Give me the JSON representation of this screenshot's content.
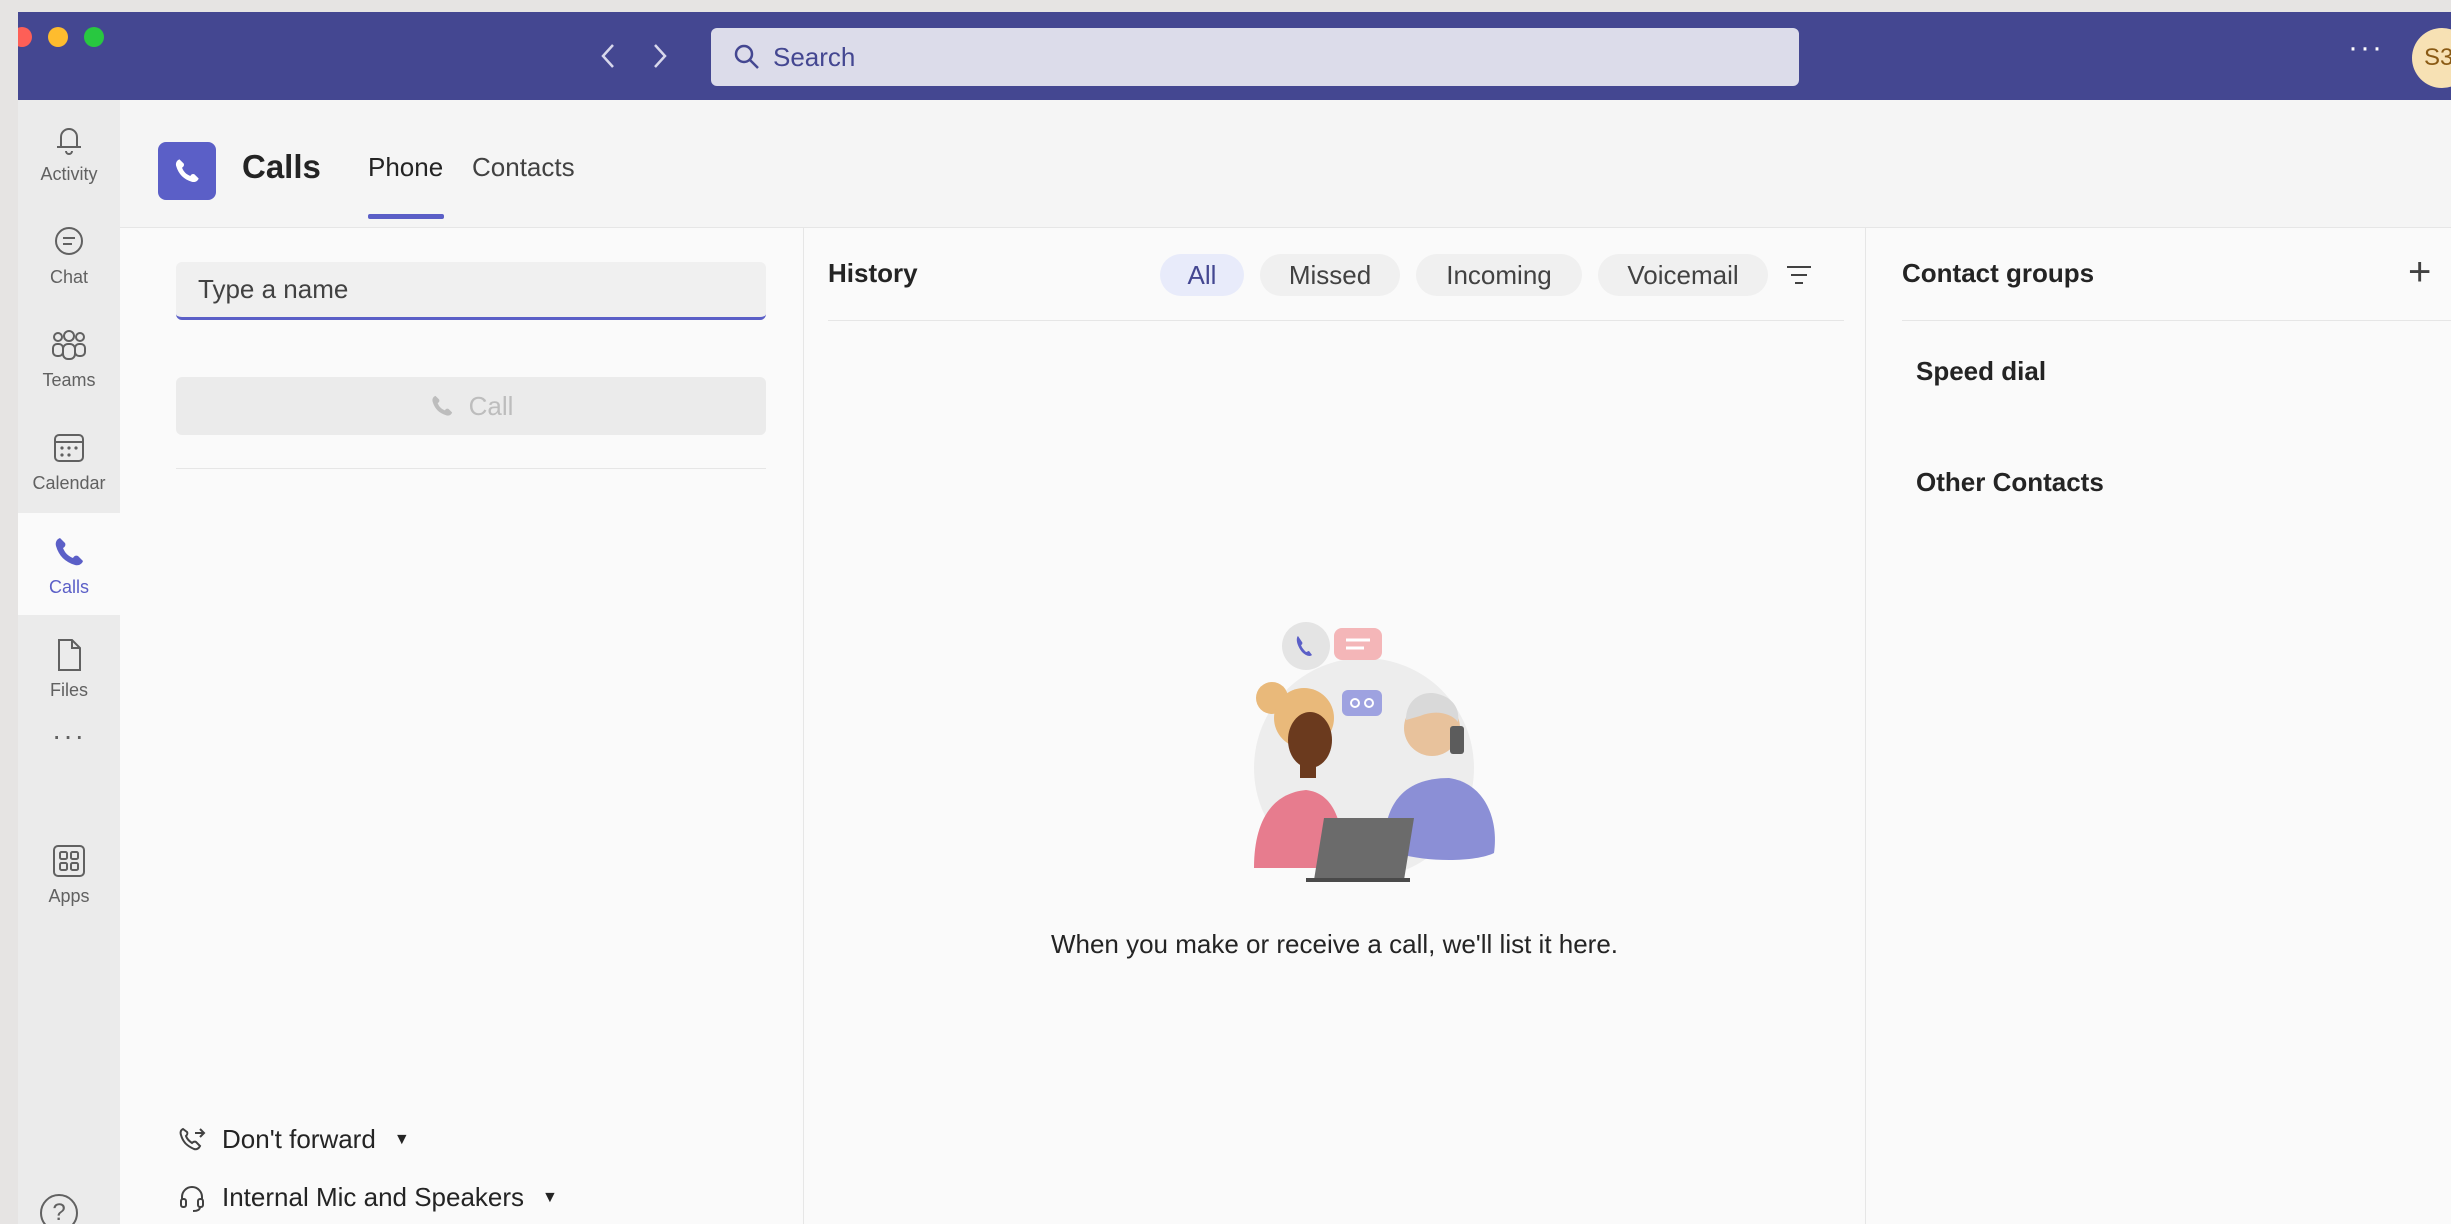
{
  "titlebar": {
    "search_placeholder": "Search",
    "more_label": "···",
    "avatar_initials": "S3"
  },
  "rail": {
    "items": [
      {
        "label": "Activity",
        "icon": "bell-icon"
      },
      {
        "label": "Chat",
        "icon": "chat-icon"
      },
      {
        "label": "Teams",
        "icon": "teams-icon"
      },
      {
        "label": "Calendar",
        "icon": "calendar-icon"
      },
      {
        "label": "Calls",
        "icon": "phone-icon",
        "active": true
      },
      {
        "label": "Files",
        "icon": "file-icon"
      },
      {
        "label": "···",
        "icon": "more-icon"
      },
      {
        "label": "Apps",
        "icon": "apps-icon"
      }
    ],
    "help_label": "?"
  },
  "header": {
    "title": "Calls",
    "tabs": [
      {
        "label": "Phone",
        "active": true
      },
      {
        "label": "Contacts",
        "active": false
      }
    ]
  },
  "dialer": {
    "input_placeholder": "Type a name",
    "call_label": "Call",
    "forward_label": "Don't forward",
    "device_label": "Internal Mic and Speakers"
  },
  "history": {
    "title": "History",
    "filters": [
      {
        "label": "All",
        "active": true
      },
      {
        "label": "Missed",
        "active": false
      },
      {
        "label": "Incoming",
        "active": false
      },
      {
        "label": "Voicemail",
        "active": false
      }
    ],
    "empty_message": "When you make or receive a call, we'll list it here."
  },
  "contacts": {
    "title": "Contact groups",
    "add_label": "+",
    "groups": [
      "Speed dial",
      "Other Contacts"
    ]
  },
  "colors": {
    "titlebar": "#444791",
    "accent": "#5b5fc7",
    "rail_bg": "#ebebeb"
  }
}
